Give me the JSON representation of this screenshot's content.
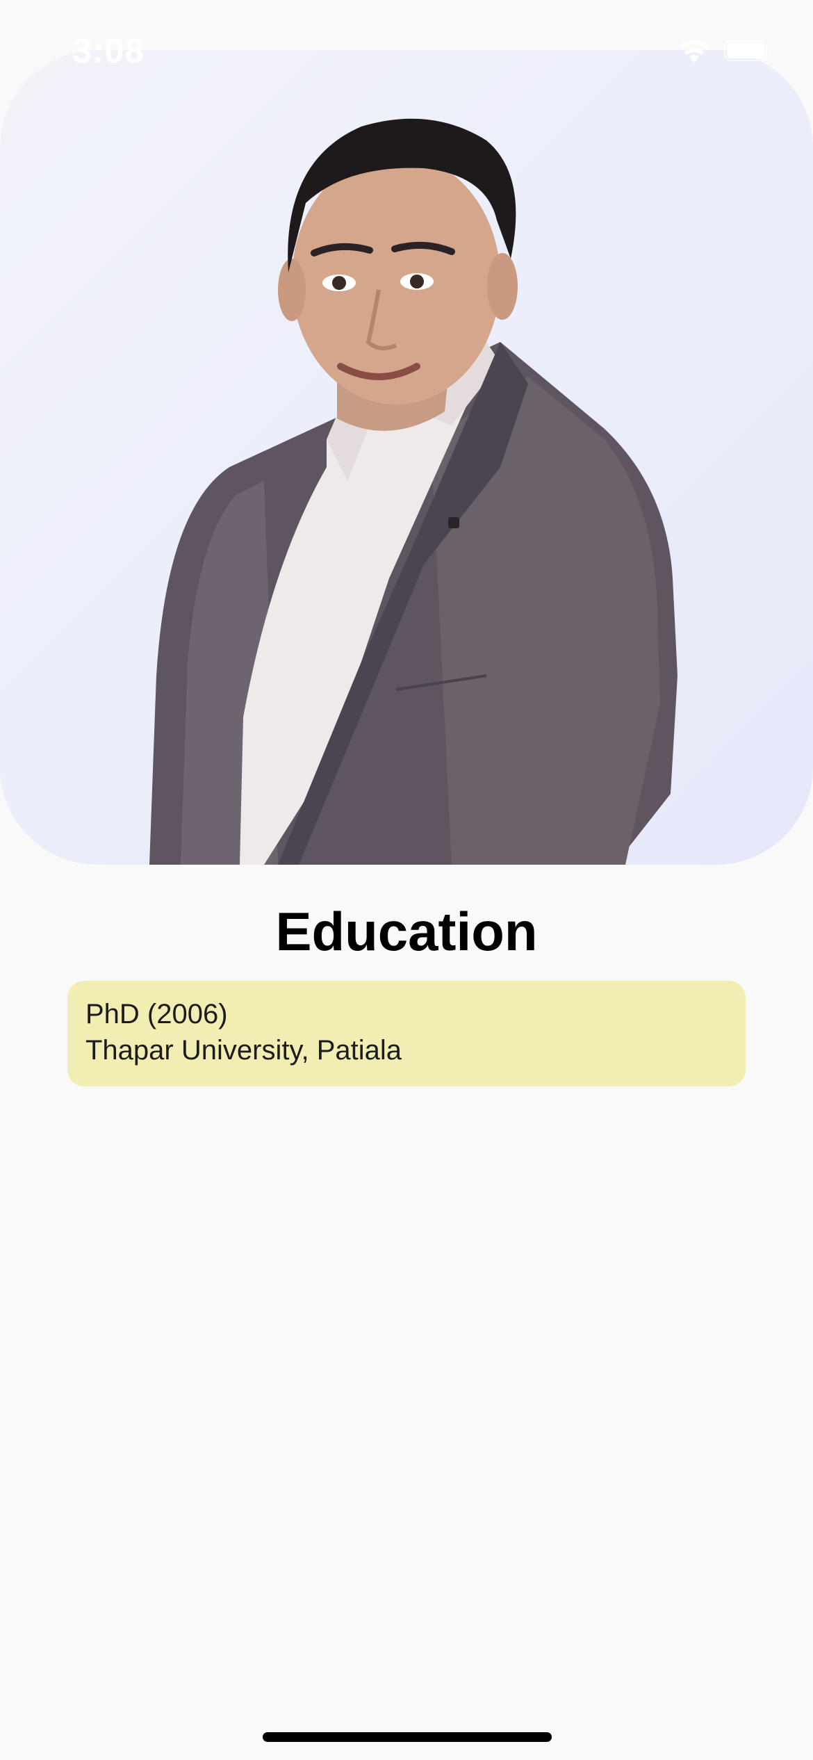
{
  "status_bar": {
    "time": "3:08",
    "wifi_icon": "wifi-icon",
    "battery_icon": "battery-icon"
  },
  "profile_photo": {
    "description_icon": "person-photo"
  },
  "education": {
    "title": "Education",
    "entries": [
      {
        "degree": "PhD (2006)",
        "institution": "Thapar University, Patiala"
      }
    ]
  },
  "colors": {
    "background": "#f9f9f9",
    "card": "#f2eeb3",
    "title": "#000000"
  }
}
